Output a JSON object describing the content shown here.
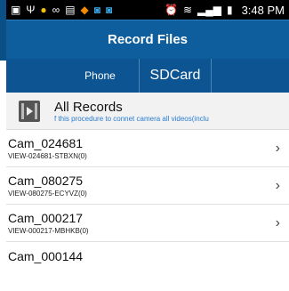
{
  "status_bar": {
    "time": "3:48 PM",
    "icons": [
      "gallery-icon",
      "usb-icon",
      "app-icon",
      "voicemail-icon",
      "image-icon",
      "app2-icon",
      "camera-icon",
      "app3-icon",
      "alarm-icon",
      "wifi-icon",
      "signal-icon",
      "battery-icon"
    ]
  },
  "header": {
    "title": "Record Files"
  },
  "tabs": [
    {
      "label": "Phone"
    },
    {
      "label": "SDCard"
    }
  ],
  "all_records": {
    "title": "All Records",
    "subtitle": "f this procedure to connet camera all videos(inclu"
  },
  "records": [
    {
      "name": "Cam_024681",
      "sub": "VIEW-024681-STBXN(0)"
    },
    {
      "name": "Cam_080275",
      "sub": "VIEW-080275-ECYVZ(0)"
    },
    {
      "name": "Cam_000217",
      "sub": "VIEW-000217-MBHKB(0)"
    }
  ],
  "partial_record": {
    "name": "Cam_000144"
  },
  "colors": {
    "title_bar": "#0e5e9e",
    "tab_bar": "#0c5592",
    "link_blue": "#2b7cd3"
  }
}
